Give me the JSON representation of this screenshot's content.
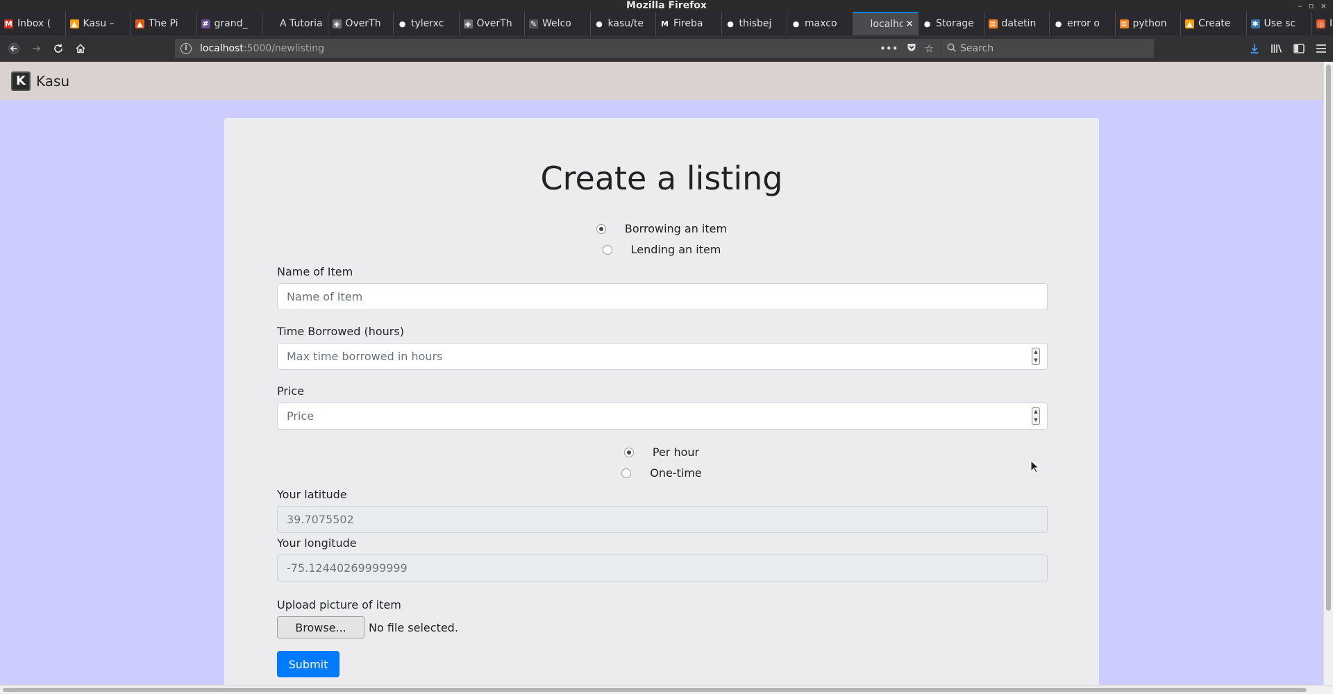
{
  "window": {
    "title": "Mozilla Firefox",
    "controls": "– ▫ ×"
  },
  "tabs": [
    {
      "label": "Inbox (",
      "icon": "gmail-icon",
      "color": "#d93025",
      "glyph": "M"
    },
    {
      "label": "Kasu –",
      "icon": "firebase-icon",
      "color": "#ffa000",
      "glyph": "▲"
    },
    {
      "label": "The Pi",
      "icon": "flame-icon",
      "color": "#e55b13",
      "glyph": "▲"
    },
    {
      "label": "grand_",
      "icon": "slack-icon",
      "color": "#6b4f8e",
      "glyph": "#"
    },
    {
      "label": "A Tutorial",
      "icon": "blank-icon",
      "color": "#2a2a2e",
      "glyph": ""
    },
    {
      "label": "OverTh",
      "icon": "overthewire-icon",
      "color": "#6f6f6f",
      "glyph": "◈"
    },
    {
      "label": "tylerxc",
      "icon": "github-icon",
      "color": "#2a2a2e",
      "glyph": "●"
    },
    {
      "label": "OverTh",
      "icon": "overthewire-icon",
      "color": "#6f6f6f",
      "glyph": "◈"
    },
    {
      "label": "Welco",
      "icon": "feather-icon",
      "color": "#555555",
      "glyph": "✎"
    },
    {
      "label": "kasu/te",
      "icon": "github-icon",
      "color": "#2a2a2e",
      "glyph": "●"
    },
    {
      "label": "Fireba",
      "icon": "medium-icon",
      "color": "#2a2a2e",
      "glyph": "M"
    },
    {
      "label": "thisbej",
      "icon": "github-icon",
      "color": "#2a2a2e",
      "glyph": "●"
    },
    {
      "label": "maxco",
      "icon": "github-icon",
      "color": "#2a2a2e",
      "glyph": "●"
    },
    {
      "label": "localho",
      "icon": "blank-icon",
      "color": "#4a4a4f",
      "glyph": "",
      "active": true
    },
    {
      "label": "Storage",
      "icon": "github-icon",
      "color": "#2a2a2e",
      "glyph": "●"
    },
    {
      "label": "datetin",
      "icon": "stackoverflow-icon",
      "color": "#f48024",
      "glyph": "≡"
    },
    {
      "label": "error o",
      "icon": "github-icon",
      "color": "#2a2a2e",
      "glyph": "●"
    },
    {
      "label": "python",
      "icon": "stackoverflow-icon",
      "color": "#f48024",
      "glyph": "≡"
    },
    {
      "label": "Create",
      "icon": "firebase-icon",
      "color": "#ffa000",
      "glyph": "▲"
    },
    {
      "label": "Use sc",
      "icon": "python-icon",
      "color": "#3776ab",
      "glyph": "✱"
    },
    {
      "label": "Introdu",
      "icon": "ubuntu-icon",
      "color": "#e95420",
      "glyph": "◎"
    }
  ],
  "nav": {
    "url_host": "localhost",
    "url_path": ":5000/newlisting",
    "search_placeholder": "Search"
  },
  "site": {
    "brand": "Kasu",
    "logo_glyph": "K"
  },
  "form": {
    "title": "Create a listing",
    "listing_type": [
      {
        "label": "Borrowing an item",
        "checked": true
      },
      {
        "label": "Lending an item",
        "checked": false
      }
    ],
    "name_label": "Name of Item",
    "name_placeholder": "Name of Item",
    "time_label": "Time Borrowed (hours)",
    "time_placeholder": "Max time borrowed in hours",
    "price_label": "Price",
    "price_placeholder": "Price",
    "price_type": [
      {
        "label": "Per hour",
        "checked": true
      },
      {
        "label": "One-time",
        "checked": false
      }
    ],
    "latitude_label": "Your latitude",
    "latitude_value": "39.7075502",
    "longitude_label": "Your longitude",
    "longitude_value": "-75.12440269999999",
    "upload_label": "Upload picture of item",
    "browse_label": "Browse...",
    "file_status": "No file selected.",
    "submit_label": "Submit"
  },
  "colors": {
    "page_bg": "#ccccff",
    "card_bg": "#ececee",
    "primary": "#007bff",
    "navbar_bg": "#d9d2d0"
  }
}
